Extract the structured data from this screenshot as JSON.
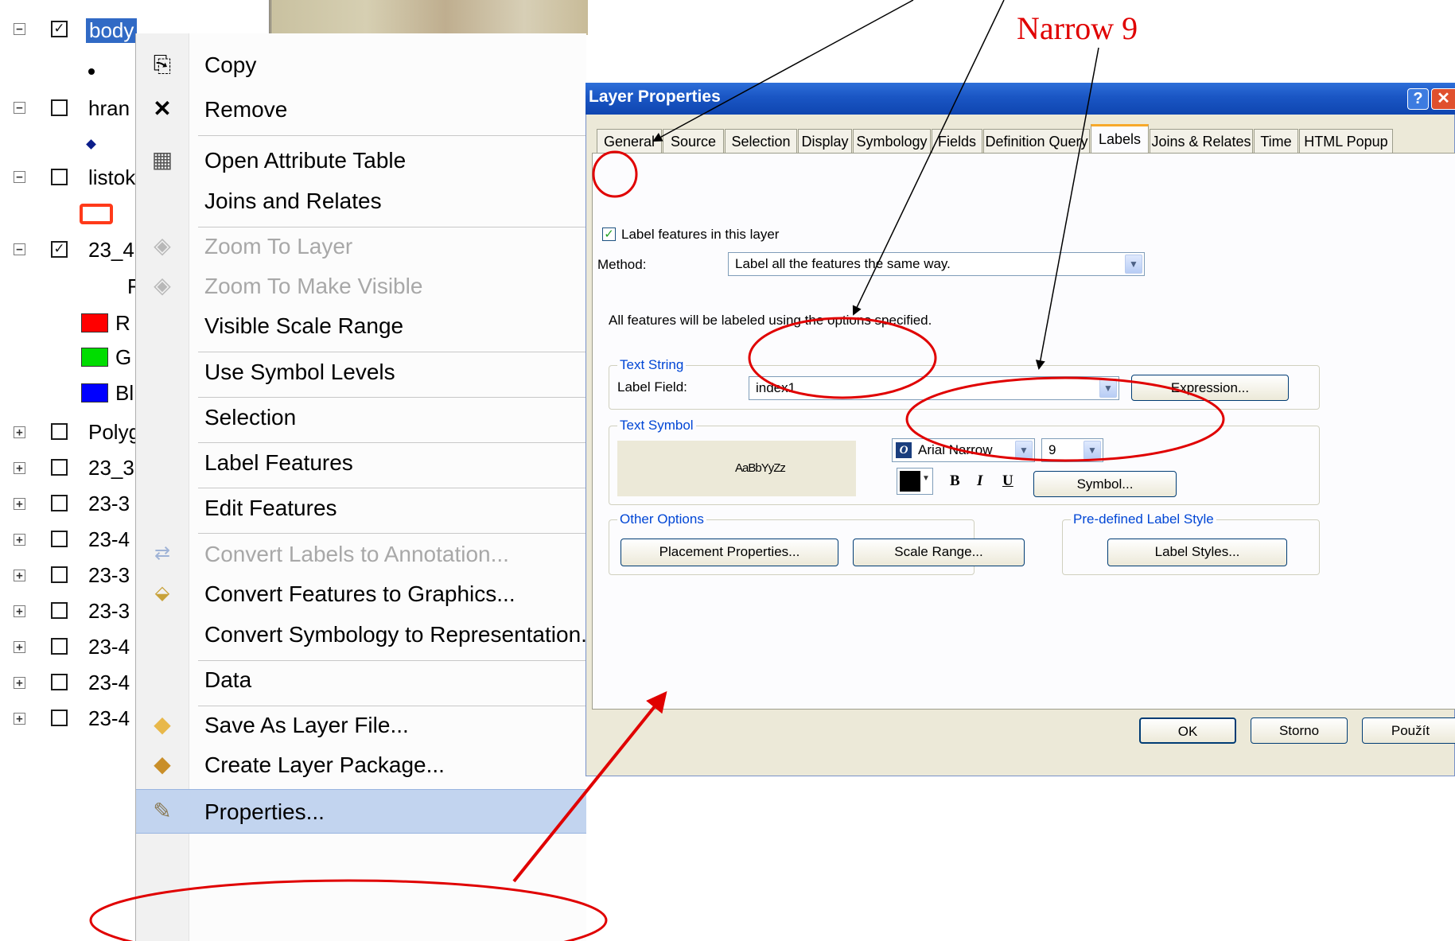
{
  "toc": {
    "layers": [
      {
        "label": "body",
        "checked": true,
        "expander": "−",
        "selected": true
      },
      {
        "label": "hran",
        "checked": false,
        "expander": "−"
      },
      {
        "label": "listok",
        "checked": false,
        "expander": "−"
      },
      {
        "label": "23_4",
        "checked": true,
        "expander": "−"
      },
      {
        "label": "Polyg",
        "checked": false,
        "expander": "+"
      },
      {
        "label": "23_3",
        "checked": false,
        "expander": "+"
      },
      {
        "label": "23-3",
        "checked": false,
        "expander": "+"
      },
      {
        "label": "23-4",
        "checked": false,
        "expander": "+"
      },
      {
        "label": "23-3",
        "checked": false,
        "expander": "+"
      },
      {
        "label": "23-3",
        "checked": false,
        "expander": "+"
      },
      {
        "label": "23-4",
        "checked": false,
        "expander": "+"
      },
      {
        "label": "23-4",
        "checked": false,
        "expander": "+"
      },
      {
        "label": "23-4",
        "checked": false,
        "expander": "+"
      }
    ],
    "rgb_header": "F",
    "rgb_bands": [
      {
        "label": "R",
        "color": "#ff0000"
      },
      {
        "label": "G",
        "color": "#00dd00"
      },
      {
        "label": "Bl",
        "color": "#0000ff"
      }
    ]
  },
  "context_menu": {
    "items": [
      {
        "label": "Copy",
        "icon": "copy-icon",
        "disabled": false
      },
      {
        "label": "Remove",
        "icon": "remove-icon",
        "disabled": false
      },
      {
        "label": "Open Attribute Table",
        "icon": "table-icon",
        "disabled": false
      },
      {
        "label": "Joins and Relates",
        "icon": "",
        "disabled": false
      },
      {
        "label": "Zoom To Layer",
        "icon": "zoom-to-layer-icon",
        "disabled": true
      },
      {
        "label": "Zoom To Make Visible",
        "icon": "zoom-visible-icon",
        "disabled": true
      },
      {
        "label": "Visible Scale Range",
        "icon": "",
        "disabled": false
      },
      {
        "label": "Use Symbol Levels",
        "icon": "",
        "disabled": false
      },
      {
        "label": "Selection",
        "icon": "",
        "disabled": false
      },
      {
        "label": "Label Features",
        "icon": "",
        "disabled": false
      },
      {
        "label": "Edit Features",
        "icon": "",
        "disabled": false
      },
      {
        "label": "Convert Labels to Annotation...",
        "icon": "convert-labels-icon",
        "disabled": true
      },
      {
        "label": "Convert Features to Graphics...",
        "icon": "convert-features-icon",
        "disabled": false
      },
      {
        "label": "Convert Symbology to Representation...",
        "icon": "",
        "disabled": false
      },
      {
        "label": "Data",
        "icon": "",
        "disabled": false
      },
      {
        "label": "Save As Layer File...",
        "icon": "layer-file-icon",
        "disabled": false
      },
      {
        "label": "Create Layer Package...",
        "icon": "layer-package-icon",
        "disabled": false
      },
      {
        "label": "Properties...",
        "icon": "properties-icon",
        "disabled": false,
        "highlighted": true
      }
    ]
  },
  "dialog": {
    "title": "Layer Properties",
    "help_button": "?",
    "close_button": "✕",
    "tabs": [
      "General",
      "Source",
      "Selection",
      "Display",
      "Symbology",
      "Fields",
      "Definition Query",
      "Labels",
      "Joins & Relates",
      "Time",
      "HTML Popup"
    ],
    "active_tab": "Labels",
    "label_features_checkbox": "Label features in this layer",
    "label_features_checked": true,
    "method_label": "Method:",
    "method_value": "Label all the features the same way.",
    "info_text": "All features will be labeled using the options specified.",
    "text_string": {
      "group_title": "Text String",
      "label_field_label": "Label Field:",
      "label_field_value": "index1",
      "expression_button": "Expression..."
    },
    "text_symbol": {
      "group_title": "Text Symbol",
      "preview_text": "AaBbYyZz",
      "font_name": "Arial Narrow",
      "font_size": "9",
      "font_color": "#000000",
      "bold_label": "B",
      "italic_label": "I",
      "underline_label": "U",
      "symbol_button": "Symbol..."
    },
    "other_options": {
      "group_title": "Other Options",
      "placement_button": "Placement Properties...",
      "scale_range_button": "Scale Range..."
    },
    "predefined": {
      "group_title": "Pre-defined Label Style",
      "label_styles_button": "Label Styles..."
    },
    "footer": {
      "ok": "OK",
      "cancel": "Storno",
      "apply": "Použít"
    }
  },
  "annotations": {
    "narrow_label": "Narrow 9",
    "color": "#e00000"
  }
}
